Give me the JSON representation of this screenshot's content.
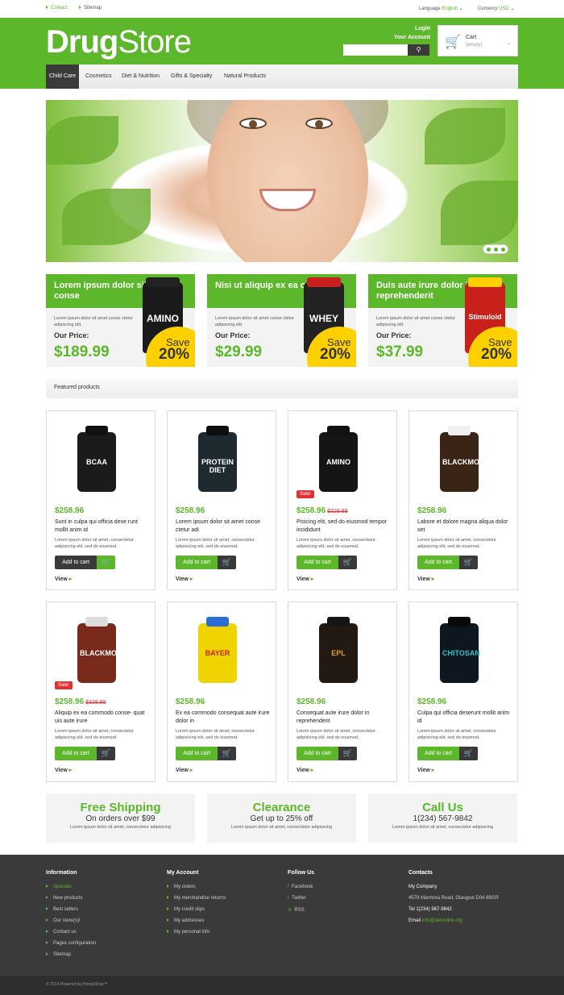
{
  "topbar": {
    "contact": "Contact",
    "sitemap": "Sitemap",
    "language_label": "Language",
    "language_value": "English",
    "currency_label": "Currency",
    "currency_value": "USD"
  },
  "header": {
    "logo_bold": "Drug",
    "logo_light": "Store",
    "login": "Login",
    "account": "Your Account",
    "search_placeholder": "",
    "cart_title": "Cart",
    "cart_status": "(empty)"
  },
  "nav": {
    "items": [
      "Child Care",
      "Cosmetics",
      "Diet & Nutrition",
      "Gifts & Specialty",
      "Natural Products"
    ]
  },
  "promos": [
    {
      "title": "Lorem ipsum dolor sit amet conse",
      "desc": "Lorem ipsum dolor sit amet conse ctetur adipiscing elit.",
      "label": "Our Price:",
      "price": "$189.99",
      "jar": "AMINO",
      "save": "Save",
      "pct": "20%"
    },
    {
      "title": "Nisi ut aliquip ex ea commodo",
      "desc": "Lorem ipsum dolor sit amet conse ctetur adipiscing elit.",
      "label": "Our Price:",
      "price": "$29.99",
      "jar": "WHEY",
      "save": "Save",
      "pct": "20%"
    },
    {
      "title": "Duis aute irure dolor in reprehenderit",
      "desc": "Lorem ipsum dolor sit amet conse ctetur adipiscing elit.",
      "label": "Our Price:",
      "price": "$37.99",
      "jar": "Stimuloid",
      "save": "Save",
      "pct": "20%"
    }
  ],
  "featured_title": "Featured products",
  "products": [
    {
      "price": "$258.96",
      "old": "",
      "sale": "",
      "name": "Sunt in culpa qui officia dese runt mollit anim id",
      "desc": "Lorem ipsum dolor sit amet, consectetur adipisicing elit, sed do eiusmod.",
      "add": "Add to cart",
      "view": "View",
      "jar": "BCAA"
    },
    {
      "price": "$258.96",
      "old": "",
      "sale": "",
      "name": "Lorem ipsum dolor sit amet conse ctetur adi",
      "desc": "Lorem ipsum dolor sit amet, consectetur adipisicing elit, sed do eiusmod.",
      "add": "Add to cart",
      "view": "View",
      "jar": "PROTEIN DIET"
    },
    {
      "price": "$258.96",
      "old": "$328.89",
      "sale": "Sale!",
      "name": "Pisicing elit, sed do eiusmod tempor incididunt",
      "desc": "Lorem ipsum dolor sit amet, consectetur adipisicing elit, sed do eiusmod.",
      "add": "Add to cart",
      "view": "View",
      "jar": "AMINO"
    },
    {
      "price": "$258.96",
      "old": "",
      "sale": "",
      "name": "Labore et dolore magna aliqua dolor set",
      "desc": "Lorem ipsum dolor sit amet, consectetur adipisicing elit, sed do eiusmod.",
      "add": "Add to cart",
      "view": "View",
      "jar": "BLACKMORES"
    },
    {
      "price": "$258.96",
      "old": "$328.89",
      "sale": "Sale!",
      "name": "Aliquip ex ea commodo conse- quat uis aute irure",
      "desc": "Lorem ipsum dolor sit amet, consectetur adipisicing elit, sed do eiusmod.",
      "add": "Add to cart",
      "view": "View",
      "jar": "BLACKMORES"
    },
    {
      "price": "$258.96",
      "old": "",
      "sale": "",
      "name": "Ex ea commodo consequat aute irure dolor in",
      "desc": "Lorem ipsum dolor sit amet, consectetur adipisicing elit, sed do eiusmod.",
      "add": "Add to cart",
      "view": "View",
      "jar": "BAYER"
    },
    {
      "price": "$258.96",
      "old": "",
      "sale": "",
      "name": "Consequat aute irure dolor in reprehenderit",
      "desc": "Lorem ipsum dolor sit amet, consectetur adipisicing elit, sed do eiusmod.",
      "add": "Add to cart",
      "view": "View",
      "jar": "EPL"
    },
    {
      "price": "$258.96",
      "old": "",
      "sale": "",
      "name": "Culpa qui officia deserunt mollit anim id",
      "desc": "Lorem ipsum dolor sit amet, consectetur adipisicing elit, sed do eiusmod.",
      "add": "Add to cart",
      "view": "View",
      "jar": "CHITOSAN"
    }
  ],
  "info": [
    {
      "t1": "Free Shipping",
      "t2": "On orders over $99",
      "t3": "Lorem ipsum dolor sit amet, consectetur adipisicing"
    },
    {
      "t1": "Clearance",
      "t2": "Get up to 25% off",
      "t3": "Lorem ipsum dolor sit amet, consectetur adipisicing"
    },
    {
      "t1": "Call Us",
      "t2": "1(234) 567-9842",
      "t3": "Lorem ipsum dolor sit amet, consectetur adipisicing"
    }
  ],
  "footer": {
    "information": {
      "title": "Information",
      "items": [
        "Specials",
        "New products",
        "Best sellers",
        "Our store(s)!",
        "Contact us",
        "Pages configuration",
        "Sitemap"
      ]
    },
    "account": {
      "title": "My Account",
      "items": [
        "My orders",
        "My merchandise returns",
        "My credit slips",
        "My addresses",
        "My personal info"
      ]
    },
    "follow": {
      "title": "Follow Us",
      "items": [
        "Facebook",
        "Twitter",
        "RSS"
      ]
    },
    "contacts": {
      "title": "Contacts",
      "company": "My Company",
      "address": "4578 Marmora Road, Glasgow D04 89GR",
      "tel": "Tel 1(234) 567-9842",
      "email_label": "Email",
      "email": "info@demolink.org"
    },
    "copyright": "© 2014 Powered by PrestaShop™"
  },
  "colors": {
    "accent": "#5cb72a",
    "dark": "#3a3a3a",
    "sale": "#e03030",
    "save": "#ffd000"
  }
}
